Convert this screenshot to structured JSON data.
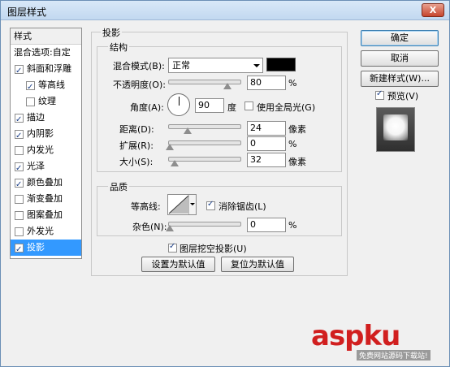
{
  "window": {
    "title": "图层样式",
    "close": "X"
  },
  "left_list": {
    "header": "样式",
    "items": [
      {
        "label": "混合选项:自定",
        "checkbox": false,
        "checked": false
      },
      {
        "label": "斜面和浮雕",
        "checkbox": true,
        "checked": true
      },
      {
        "label": "等高线",
        "checkbox": true,
        "checked": true
      },
      {
        "label": "纹理",
        "checkbox": true,
        "checked": false
      },
      {
        "label": "描边",
        "checkbox": true,
        "checked": true
      },
      {
        "label": "内阴影",
        "checkbox": true,
        "checked": true
      },
      {
        "label": "内发光",
        "checkbox": true,
        "checked": false
      },
      {
        "label": "光泽",
        "checkbox": true,
        "checked": true
      },
      {
        "label": "颜色叠加",
        "checkbox": true,
        "checked": true
      },
      {
        "label": "渐变叠加",
        "checkbox": true,
        "checked": false
      },
      {
        "label": "图案叠加",
        "checkbox": true,
        "checked": false
      },
      {
        "label": "外发光",
        "checkbox": true,
        "checked": false
      },
      {
        "label": "投影",
        "checkbox": true,
        "checked": true,
        "selected": true
      }
    ]
  },
  "shadow": {
    "section_title": "投影",
    "structure": {
      "title": "结构",
      "blend_mode_label": "混合模式(B):",
      "blend_mode_value": "正常",
      "color": "#000000",
      "opacity_label": "不透明度(O):",
      "opacity_value": "80",
      "opacity_unit": "%",
      "angle_label": "角度(A):",
      "angle_value": "90",
      "angle_unit": "度",
      "global_light_label": "使用全局光(G)",
      "global_light_checked": false,
      "distance_label": "距离(D):",
      "distance_value": "24",
      "distance_unit": "像素",
      "spread_label": "扩展(R):",
      "spread_value": "0",
      "spread_unit": "%",
      "size_label": "大小(S):",
      "size_value": "32",
      "size_unit": "像素"
    },
    "quality": {
      "title": "品质",
      "contour_label": "等高线:",
      "antialias_label": "消除锯齿(L)",
      "antialias_checked": true,
      "noise_label": "杂色(N):",
      "noise_value": "0",
      "noise_unit": "%"
    },
    "knockout_label": "图层挖空投影(U)",
    "knockout_checked": true,
    "set_default_label": "设置为默认值",
    "reset_default_label": "复位为默认值"
  },
  "right_buttons": {
    "ok": "确定",
    "cancel": "取消",
    "new_style": "新建样式(W)...",
    "preview_label": "预览(V)",
    "preview_checked": true
  },
  "watermark": {
    "brand": "aspku",
    "sub": "免费网站源码下载站!"
  },
  "colors": {
    "accent_selected": "#3399ff",
    "watermark": "#d11f1f"
  }
}
